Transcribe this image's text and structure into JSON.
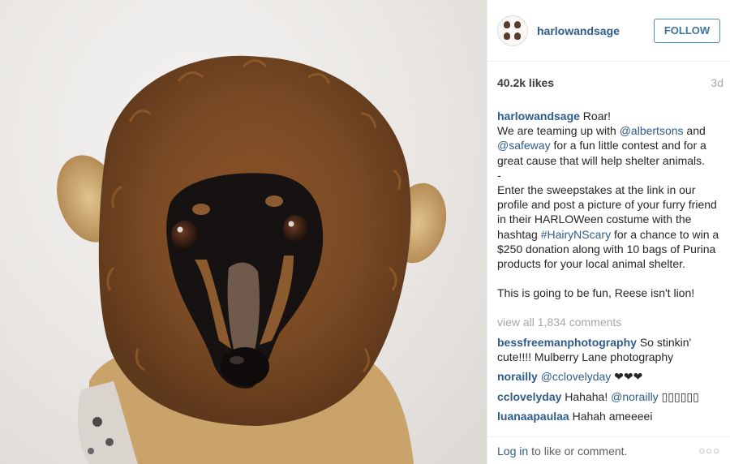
{
  "post": {
    "photo_alt": "photo-of-dachshund-in-lion-mane-costume",
    "header": {
      "username": "harlowandsage",
      "follow_label": "FOLLOW"
    },
    "likes": "40.2k likes",
    "age": "3d",
    "caption": {
      "username": "harlowandsage",
      "l1_rest": " Roar!",
      "l2_pre": "We are teaming up with ",
      "mention1": "@albertsons",
      "l2_post": " and",
      "mention2": "@safeway",
      "l3_post": " for a fun little contest and for a great cause that will help shelter animals.",
      "dash": "-",
      "p2_pre": "Enter the sweepstakes at the link in our profile and post a picture of your furry friend in their HARLOWeen costume with the hashtag ",
      "hashtag": "#HairyNScary",
      "p2_post": " for a chance to win a $250 donation along with 10 bags of Purina products for your local animal shelter.",
      "p3": "This is going to be fun, Reese isn't lion!"
    },
    "view_all": "view all 1,834 comments",
    "comments": [
      {
        "user": "bessfreemanphotography",
        "text": " So stinkin' cute!!!! Mulberry Lane photography",
        "mention": ""
      },
      {
        "user": "norailly",
        "text": " ❤❤❤",
        "mention": "@cclovelyday"
      },
      {
        "user": "cclovelyday",
        "text": " Hahaha! ",
        "mention": "@norailly",
        "tail": " ▯▯▯▯▯▯"
      },
      {
        "user": "luanaapaulaa",
        "text": " Hahah ameeeei",
        "mention": ""
      }
    ],
    "footer": {
      "login": "Log in",
      "rest": "to like or comment.",
      "more_icon": "more-options-icon"
    }
  }
}
